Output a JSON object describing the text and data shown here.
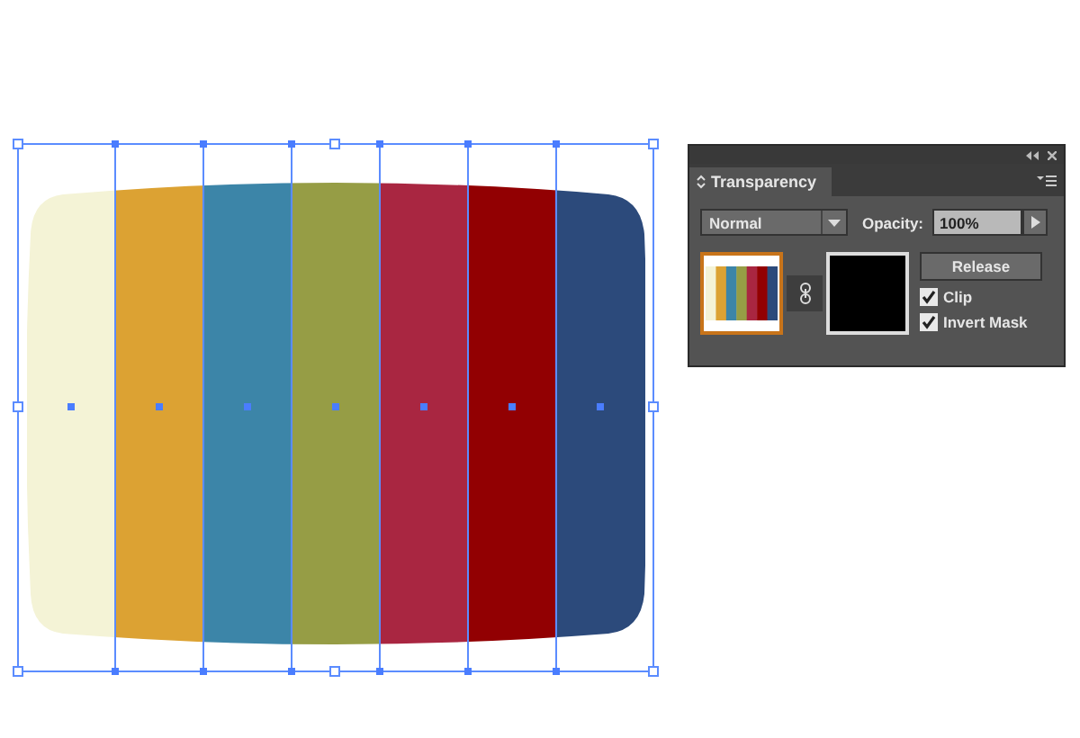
{
  "artwork": {
    "stripes": [
      {
        "color": "#f4f3d6"
      },
      {
        "color": "#dca233"
      },
      {
        "color": "#3c85a8"
      },
      {
        "color": "#969d45"
      },
      {
        "color": "#a92641"
      },
      {
        "color": "#920002"
      },
      {
        "color": "#2c4a7b"
      }
    ]
  },
  "panel": {
    "tab": "Transparency",
    "blend_mode": "Normal",
    "opacity_label": "Opacity:",
    "opacity": "100%",
    "release_button": "Release",
    "options": [
      {
        "label": "Clip",
        "checked": true
      },
      {
        "label": "Invert Mask",
        "checked": true
      }
    ]
  }
}
